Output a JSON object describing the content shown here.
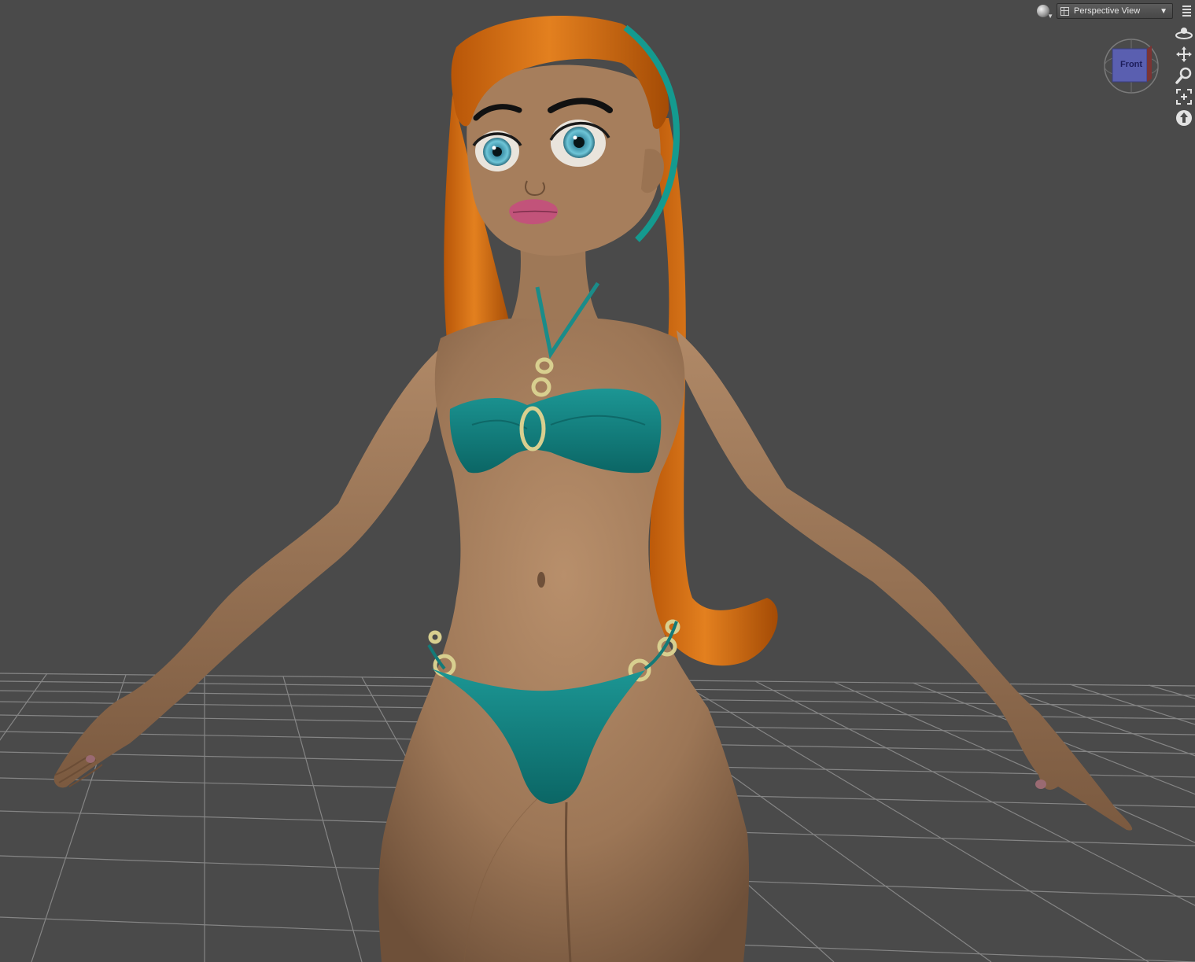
{
  "toolbar": {
    "render_mode_icon": "sphere-shading-icon",
    "view_selector_label": "Perspective View",
    "view_selector_icon": "camera-view-icon",
    "menu_icon": "options-menu-icon"
  },
  "view_cube": {
    "face_label": "Front"
  },
  "nav_tools": [
    {
      "icon": "orbit-icon"
    },
    {
      "icon": "pan-icon"
    },
    {
      "icon": "zoom-icon"
    },
    {
      "icon": "frame-icon"
    },
    {
      "icon": "reset-view-icon"
    }
  ],
  "colors": {
    "background": "#4a4a4a",
    "grid_line": "#8e8e8e",
    "skin": "#a7805e",
    "hair": "#d4690f",
    "swimsuit": "#12807f",
    "ring_gold": "#d8cf8f",
    "eye_iris": "#4fb3c9",
    "lips": "#c2537a"
  }
}
